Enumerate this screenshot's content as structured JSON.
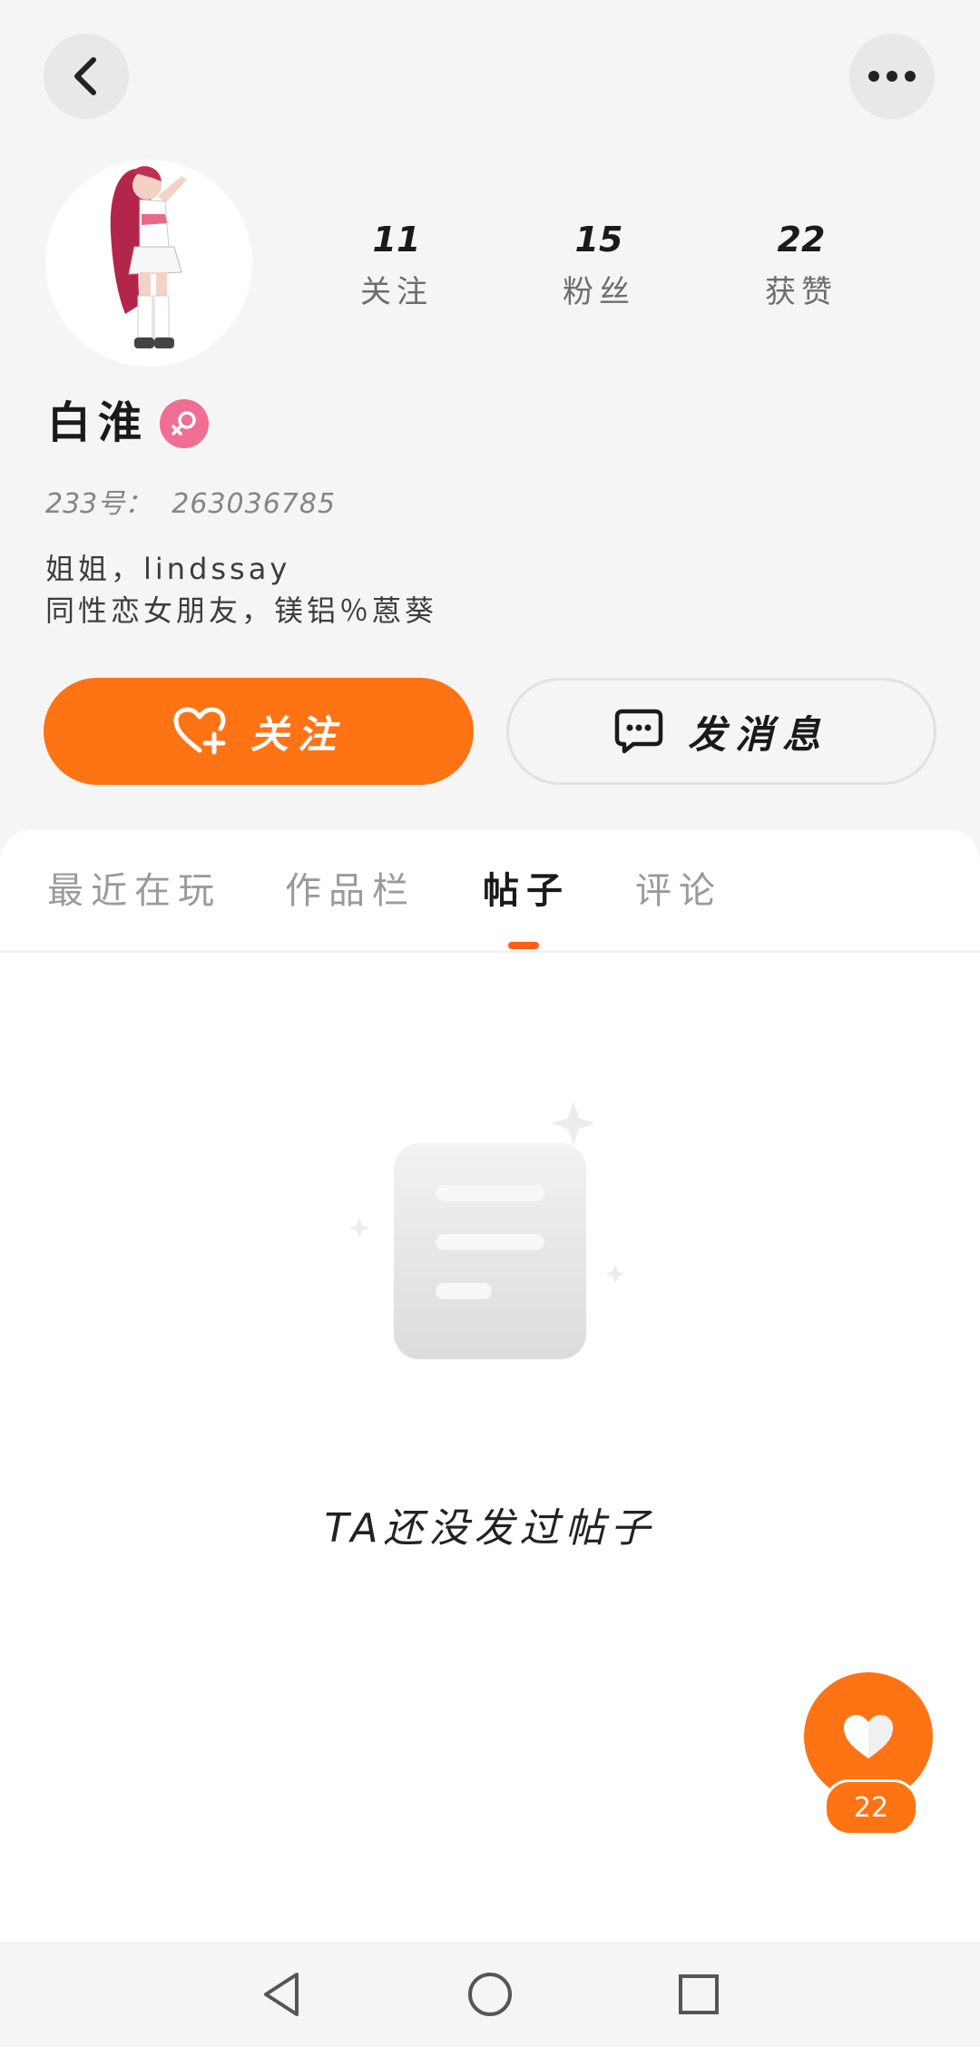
{
  "header": {
    "back_icon": "chevron-left-icon",
    "more_icon": "more-horizontal-icon"
  },
  "profile": {
    "avatar_icon": "anime-girl-avatar",
    "name": "白淮",
    "gender_icon": "female-icon",
    "gender_color": "#f06d93",
    "id_label": "233号：",
    "id_value": "263036785",
    "bio_line1": "姐姐，lindssay",
    "bio_line2": "同性恋女朋友，镁铝％蒽葵"
  },
  "stats": [
    {
      "value": "11",
      "label": "关注"
    },
    {
      "value": "15",
      "label": "粉丝"
    },
    {
      "value": "22",
      "label": "获赞"
    }
  ],
  "actions": {
    "follow_label": "关注",
    "follow_icon": "heart-plus-icon",
    "message_label": "发消息",
    "message_icon": "chat-bubble-icon",
    "accent_color": "#fe7314"
  },
  "tabs": [
    {
      "label": "最近在玩",
      "active": false
    },
    {
      "label": "作品栏",
      "active": false
    },
    {
      "label": "帖子",
      "active": true
    },
    {
      "label": "评论",
      "active": false
    }
  ],
  "empty_state": {
    "icon": "empty-document-icon",
    "text": "TA还没发过帖子"
  },
  "like_fab": {
    "icon": "heart-icon",
    "count": "22"
  },
  "navbar": {
    "back_icon": "nav-back-triangle-icon",
    "home_icon": "nav-home-circle-icon",
    "recents_icon": "nav-recents-square-icon"
  }
}
